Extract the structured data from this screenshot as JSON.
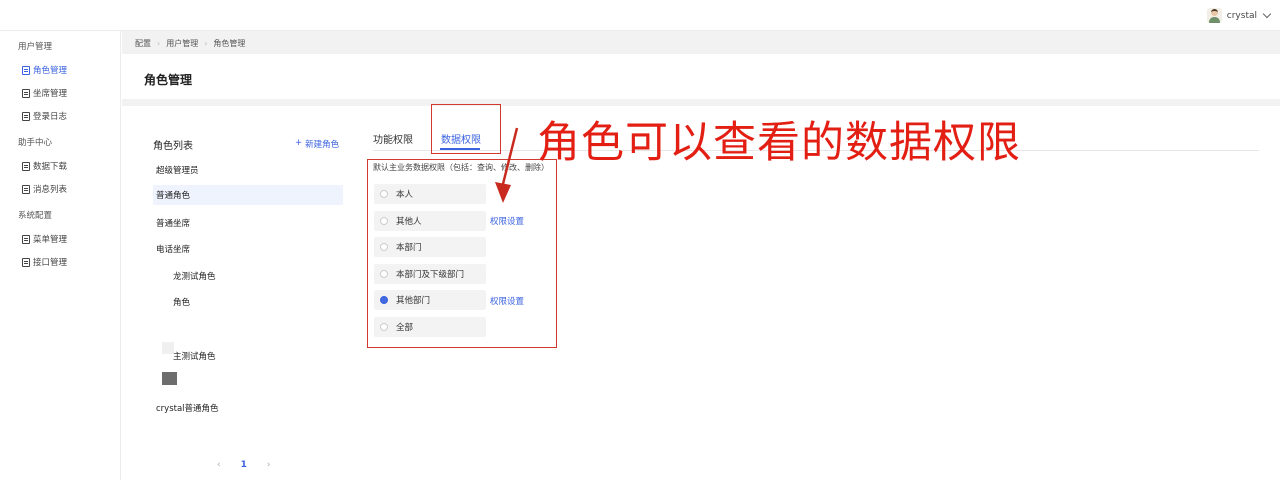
{
  "topbar": {
    "username": "crystal"
  },
  "sidebar": {
    "groups": [
      {
        "label": "用户管理",
        "items": [
          {
            "label": "角色管理",
            "active": true
          },
          {
            "label": "坐席管理"
          },
          {
            "label": "登录日志"
          }
        ]
      },
      {
        "label": "助手中心",
        "items": [
          {
            "label": "数据下载"
          },
          {
            "label": "消息列表"
          }
        ]
      },
      {
        "label": "系统配置",
        "items": [
          {
            "label": "菜单管理"
          },
          {
            "label": "接口管理"
          }
        ]
      }
    ]
  },
  "breadcrumb": [
    "配置",
    "用户管理",
    "角色管理"
  ],
  "page_title": "角色管理",
  "role_list": {
    "title": "角色列表",
    "new_button": "新建角色",
    "roles": [
      "超级管理员",
      "普通角色",
      "普通坐席",
      "电话坐席",
      "龙测试角色",
      "角色",
      "主测试角色",
      "crystal普通角色"
    ],
    "selected": "普通角色"
  },
  "pagination": {
    "prev": "‹",
    "current": "1",
    "next": "›"
  },
  "tabs": [
    {
      "label": "功能权限"
    },
    {
      "label": "数据权限",
      "active": true
    }
  ],
  "data_permission": {
    "hint": "默认主业务数据权限（包括：查询、修改、删除）",
    "options": [
      "本人",
      "其他人",
      "本部门",
      "本部门及下级部门",
      "其他部门",
      "全部"
    ],
    "selected": "其他部门",
    "settings_link": "权限设置"
  },
  "annotation": {
    "text": "角色可以查看的数据权限",
    "color": "#e31f14"
  },
  "colors": {
    "accent": "#3b63e0",
    "annotation": "#d23a2e"
  }
}
